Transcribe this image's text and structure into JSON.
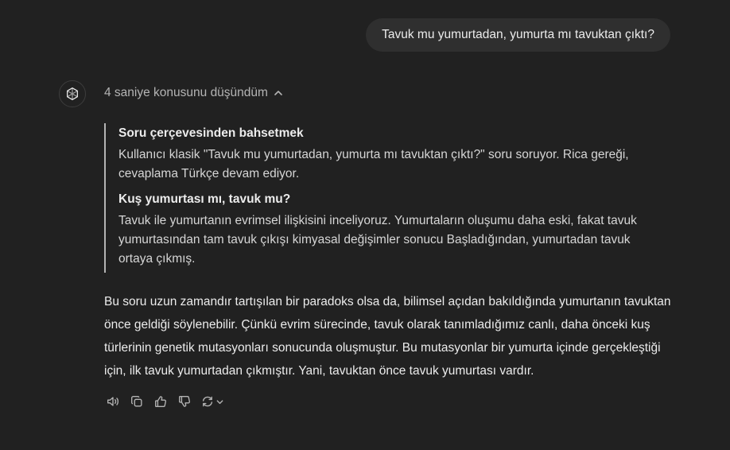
{
  "user_message": "Tavuk mu yumurtadan, yumurta mı tavuktan çıktı?",
  "assistant": {
    "avatar_icon": "openai-logo-icon",
    "thought_label": "4 saniye konusunu düşündüm",
    "reasoning": [
      {
        "title": "Soru çerçevesinden bahsetmek",
        "text": "Kullanıcı klasik \"Tavuk mu yumurtadan, yumurta mı tavuktan çıktı?\" soru soruyor. Rica gereği, cevaplama Türkçe devam ediyor."
      },
      {
        "title": "Kuş yumurtası mı, tavuk mu?",
        "text": "Tavuk ile yumurtanın evrimsel ilişkisini inceliyoruz. Yumurtaların oluşumu daha eski, fakat tavuk yumurtasından tam tavuk çıkışı kimyasal değişimler sonucu Başladığından, yumurtadan tavuk ortaya çıkmış."
      }
    ],
    "answer": "Bu soru uzun zamandır tartışılan bir paradoks olsa da, bilimsel açıdan bakıldığında yumurtanın tavuktan önce geldiği söylenebilir. Çünkü evrim sürecinde, tavuk olarak tanımladığımız canlı, daha önceki kuş türlerinin genetik mutasyonları sonucunda oluşmuştur. Bu mutasyonlar bir yumurta içinde gerçekleştiği için, ilk tavuk yumurtadan çıkmıştır. Yani, tavuktan önce tavuk yumurtası vardır."
  },
  "actions": [
    "speaker-icon",
    "copy-icon",
    "thumbs-up-icon",
    "thumbs-down-icon",
    "regenerate-icon",
    "chevron-down-icon"
  ],
  "colors": {
    "background": "#212121",
    "user_bubble": "#2f2f2f",
    "text": "#ececec",
    "muted": "#b4b4b4"
  }
}
